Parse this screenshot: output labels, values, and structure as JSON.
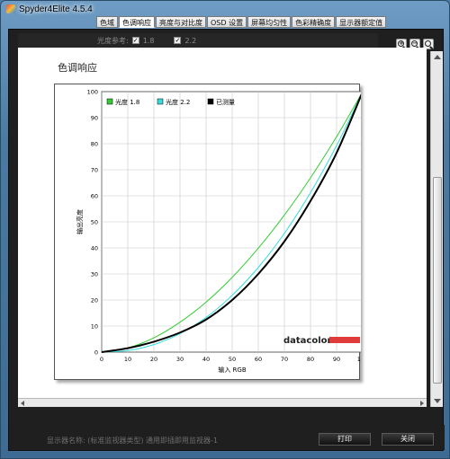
{
  "window": {
    "title": "Spyder4Elite 4.5.4"
  },
  "tabs": [
    {
      "label": "色域",
      "active": false
    },
    {
      "label": "色调响应",
      "active": true
    },
    {
      "label": "亮度与对比度",
      "active": false
    },
    {
      "label": "OSD 设置",
      "active": false
    },
    {
      "label": "屏幕均匀性",
      "active": false
    },
    {
      "label": "色彩精确度",
      "active": false
    },
    {
      "label": "显示器额定值",
      "active": false
    }
  ],
  "toolbar": {
    "ref_label": "光度参考:",
    "gamma_options": [
      {
        "value": "1.8",
        "checked": true
      },
      {
        "value": "2.2",
        "checked": true
      }
    ],
    "zoom_buttons": [
      "zoom-in-icon",
      "zoom-out-icon",
      "zoom-fit-icon"
    ]
  },
  "section": {
    "title": "色调响应"
  },
  "chart_data": {
    "type": "line",
    "xlabel": "输入 RGB",
    "ylabel": "输出亮度",
    "xlim": [
      0,
      100
    ],
    "ylim": [
      0,
      100
    ],
    "xticks": [
      0,
      10,
      20,
      30,
      40,
      50,
      60,
      70,
      80,
      90,
      100
    ],
    "yticks": [
      0,
      10,
      20,
      30,
      40,
      50,
      60,
      70,
      80,
      90,
      100
    ],
    "grid": true,
    "legend_position": "top-left",
    "watermark": "datacolor",
    "series": [
      {
        "name": "光度 1.8",
        "color": "#33cc33",
        "x": [
          0,
          10,
          20,
          30,
          40,
          50,
          60,
          70,
          80,
          90,
          100
        ],
        "y": [
          0,
          1.6,
          5.5,
          11.5,
          19.2,
          28.7,
          39.9,
          52.6,
          66.9,
          82.7,
          100
        ]
      },
      {
        "name": "光度 2.2",
        "color": "#33dddd",
        "x": [
          0,
          10,
          20,
          30,
          40,
          50,
          60,
          70,
          80,
          90,
          100
        ],
        "y": [
          0,
          0.6,
          2.9,
          7.1,
          13.3,
          21.8,
          32.5,
          45.6,
          61.2,
          79.3,
          100
        ]
      },
      {
        "name": "已测量",
        "color": "#000000",
        "x": [
          0,
          10,
          20,
          30,
          40,
          50,
          60,
          70,
          80,
          90,
          100
        ],
        "y": [
          0,
          1.5,
          4.0,
          7.5,
          12.5,
          20.0,
          30.0,
          42.5,
          58.0,
          76.5,
          100
        ]
      }
    ]
  },
  "footer": {
    "monitor_info": "显示器名称: (标准监视器类型) 通用即插即用监视器-1",
    "print_label": "打印",
    "close_label": "关闭"
  }
}
